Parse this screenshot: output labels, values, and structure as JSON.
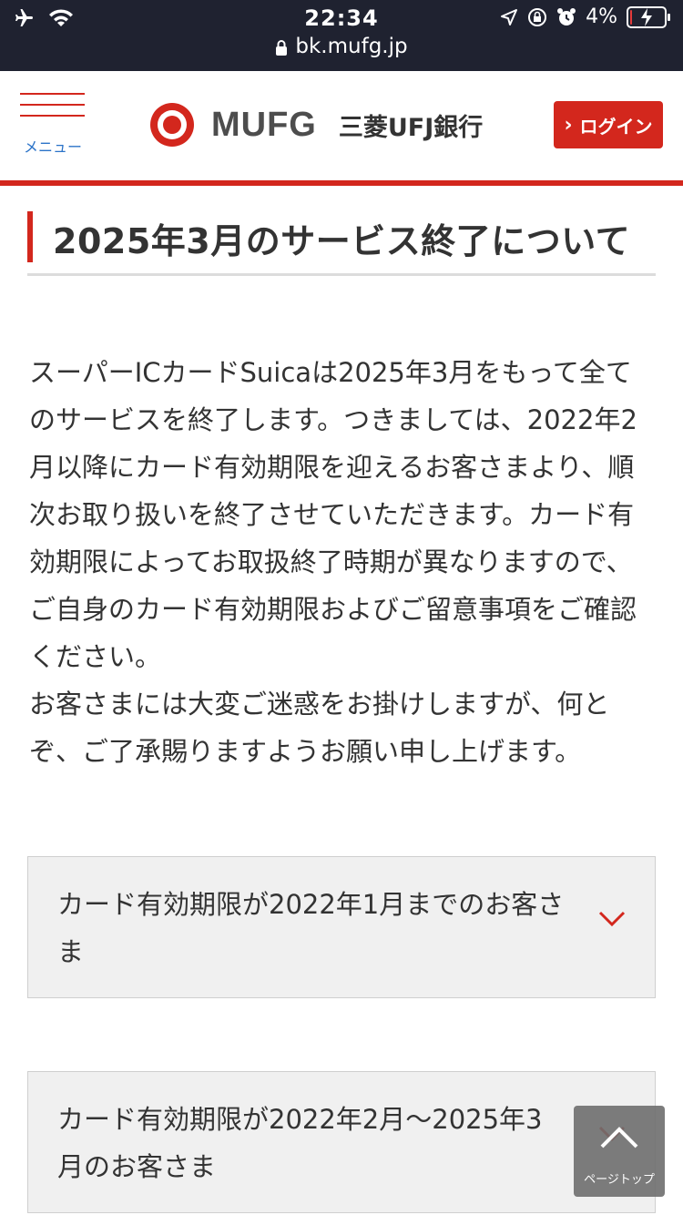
{
  "status_bar": {
    "time": "22:34",
    "battery_text": "4%",
    "battery_level": 0.04,
    "url": "bk.mufg.jp",
    "icons": [
      "airplane-icon",
      "wifi-icon",
      "location-icon",
      "rotation-lock-icon",
      "alarm-icon",
      "battery-icon",
      "lock-icon"
    ]
  },
  "header": {
    "menu_label": "メニュー",
    "logo_text": "MUFG",
    "bank_name": "三菱UFJ銀行",
    "login_label": "ログイン",
    "accent_color": "#d3271d"
  },
  "page": {
    "title": "2025年3月のサービス終了について",
    "body_paragraphs": [
      "スーパーICカードSuicaは2025年3月をもって全てのサービスを終了します。つきましては、2022年2月以降にカード有効期限を迎えるお客さまより、順次お取り扱いを終了させていただきます。カード有効期限によってお取扱終了時期が異なりますので、ご自身のカード有効期限およびご留意事項をご確認ください。",
      "お客さまには大変ご迷惑をお掛けしますが、何とぞ、ご了承賜りますようお願い申し上げます。"
    ]
  },
  "accordions": [
    {
      "label": "カード有効期限が2022年1月までのお客さま",
      "expanded": false
    },
    {
      "label": "カード有効期限が2022年2月～2025年3月のお客さま",
      "expanded": false
    }
  ],
  "page_top_label": "ページトップ"
}
